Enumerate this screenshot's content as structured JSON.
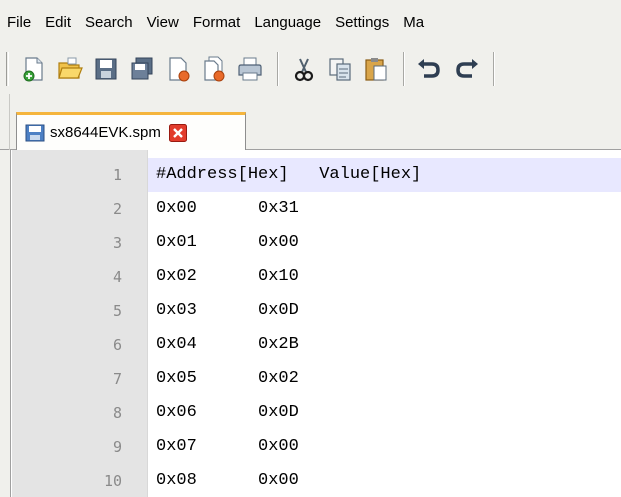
{
  "menu": [
    "File",
    "Edit",
    "Search",
    "View",
    "Format",
    "Language",
    "Settings",
    "Ma"
  ],
  "toolbar": {
    "buttons": [
      "new-file",
      "open-file",
      "save",
      "save-all",
      "close",
      "close-all",
      "print",
      "cut",
      "copy",
      "paste",
      "undo",
      "redo"
    ]
  },
  "tab": {
    "label": "sx8644EVK.spm"
  },
  "editor": {
    "lines": [
      {
        "num": "1",
        "text": "#Address[Hex]   Value[Hex]"
      },
      {
        "num": "2",
        "text": "0x00      0x31"
      },
      {
        "num": "3",
        "text": "0x01      0x00"
      },
      {
        "num": "4",
        "text": "0x02      0x10"
      },
      {
        "num": "5",
        "text": "0x03      0x0D"
      },
      {
        "num": "6",
        "text": "0x04      0x2B"
      },
      {
        "num": "7",
        "text": "0x05      0x02"
      },
      {
        "num": "8",
        "text": "0x06      0x0D"
      },
      {
        "num": "9",
        "text": "0x07      0x00"
      },
      {
        "num": "10",
        "text": "0x08      0x00"
      }
    ]
  },
  "colors": {
    "current_line": "#e8e8ff",
    "gutter": "#e4e4e4",
    "tab_accent": "#f5b53d",
    "close_red": "#e23c2c"
  }
}
